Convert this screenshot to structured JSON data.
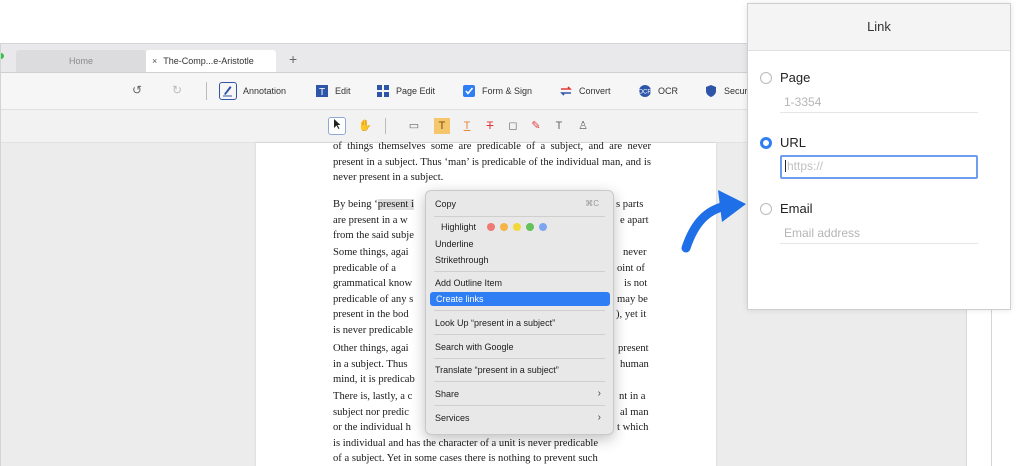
{
  "tabs": {
    "home": "Home",
    "doc": "The-Comp...e-Aristotle",
    "close": "×",
    "add": "+"
  },
  "toolbar": {
    "undo": "↺",
    "redo": "↻",
    "annotation": "Annotation",
    "edit": "Edit",
    "page_edit": "Page Edit",
    "form_sign": "Form & Sign",
    "convert": "Convert",
    "ocr": "OCR",
    "security": "Secur"
  },
  "annotation_tools": [
    "select-tool",
    "hand-tool",
    "comment-tool",
    "highlight-tool",
    "underline-tool",
    "strikethrough-tool",
    "shape-tool",
    "pencil-tool",
    "text-tool",
    "stamp-tool"
  ],
  "document": {
    "p0": "of things themselves some are predicable of a subject, and are never present in a subject. Thus ‘man’ is predicable of the individual man, and is never present in a subject.",
    "p1_pre": "By being ‘",
    "p1_hl": "present i",
    "p1_a": "s parts",
    "p1_b": "are present in a w",
    "p1_b2": "e apart",
    "p1_c": "from the said subje",
    "p2_a": "Some things, agai",
    "p2_a2": "never",
    "p2_b": "predicable of a",
    "p2_b2": "oint of",
    "p2_c": "grammatical know",
    "p2_c2": "is not",
    "p2_d": "predicable of any s",
    "p2_d2": "may be",
    "p2_e": "present in the bod",
    "p2_e2": "), yet it",
    "p2_f": "is never predicable",
    "p3_a": "Other things, agai",
    "p3_a2": "present",
    "p3_b": "in a subject. Thus",
    "p3_b2": "human",
    "p3_c": "mind, it is predicab",
    "p4_a": "There is, lastly, a c",
    "p4_a2": "nt in a",
    "p4_b": "subject nor predic",
    "p4_b2": "al man",
    "p4_c": "or the individual h",
    "p4_c2": "t which",
    "p4_d": "is individual and has the character of a unit is never predicable",
    "p4_e": "of a subject. Yet in some cases there is nothing to prevent such"
  },
  "context_menu": {
    "copy": "Copy",
    "copy_shortcut": "⌘C",
    "highlight": "Highlight",
    "highlight_colors": [
      "#ee7a74",
      "#f5b443",
      "#f2d83a",
      "#63c25a",
      "#7ea6ee"
    ],
    "underline": "Underline",
    "strikethrough": "Strikethrough",
    "add_outline": "Add Outline Item",
    "create_links": "Create links",
    "look_up": "Look Up “present in a subject”",
    "search_google": "Search with Google",
    "translate": "Translate “present in a subject”",
    "share": "Share",
    "services": "Services",
    "submenu_chevron": "›"
  },
  "link_dialog": {
    "title": "Link",
    "page_label": "Page",
    "page_placeholder": "1-3354",
    "url_label": "URL",
    "url_placeholder": "https://",
    "email_label": "Email",
    "email_placeholder": "Email address",
    "selected": "URL"
  },
  "colors": {
    "accent": "#2f7ef3",
    "arrow": "#1e6fe8",
    "menu_selected": "#2f7ef3"
  }
}
